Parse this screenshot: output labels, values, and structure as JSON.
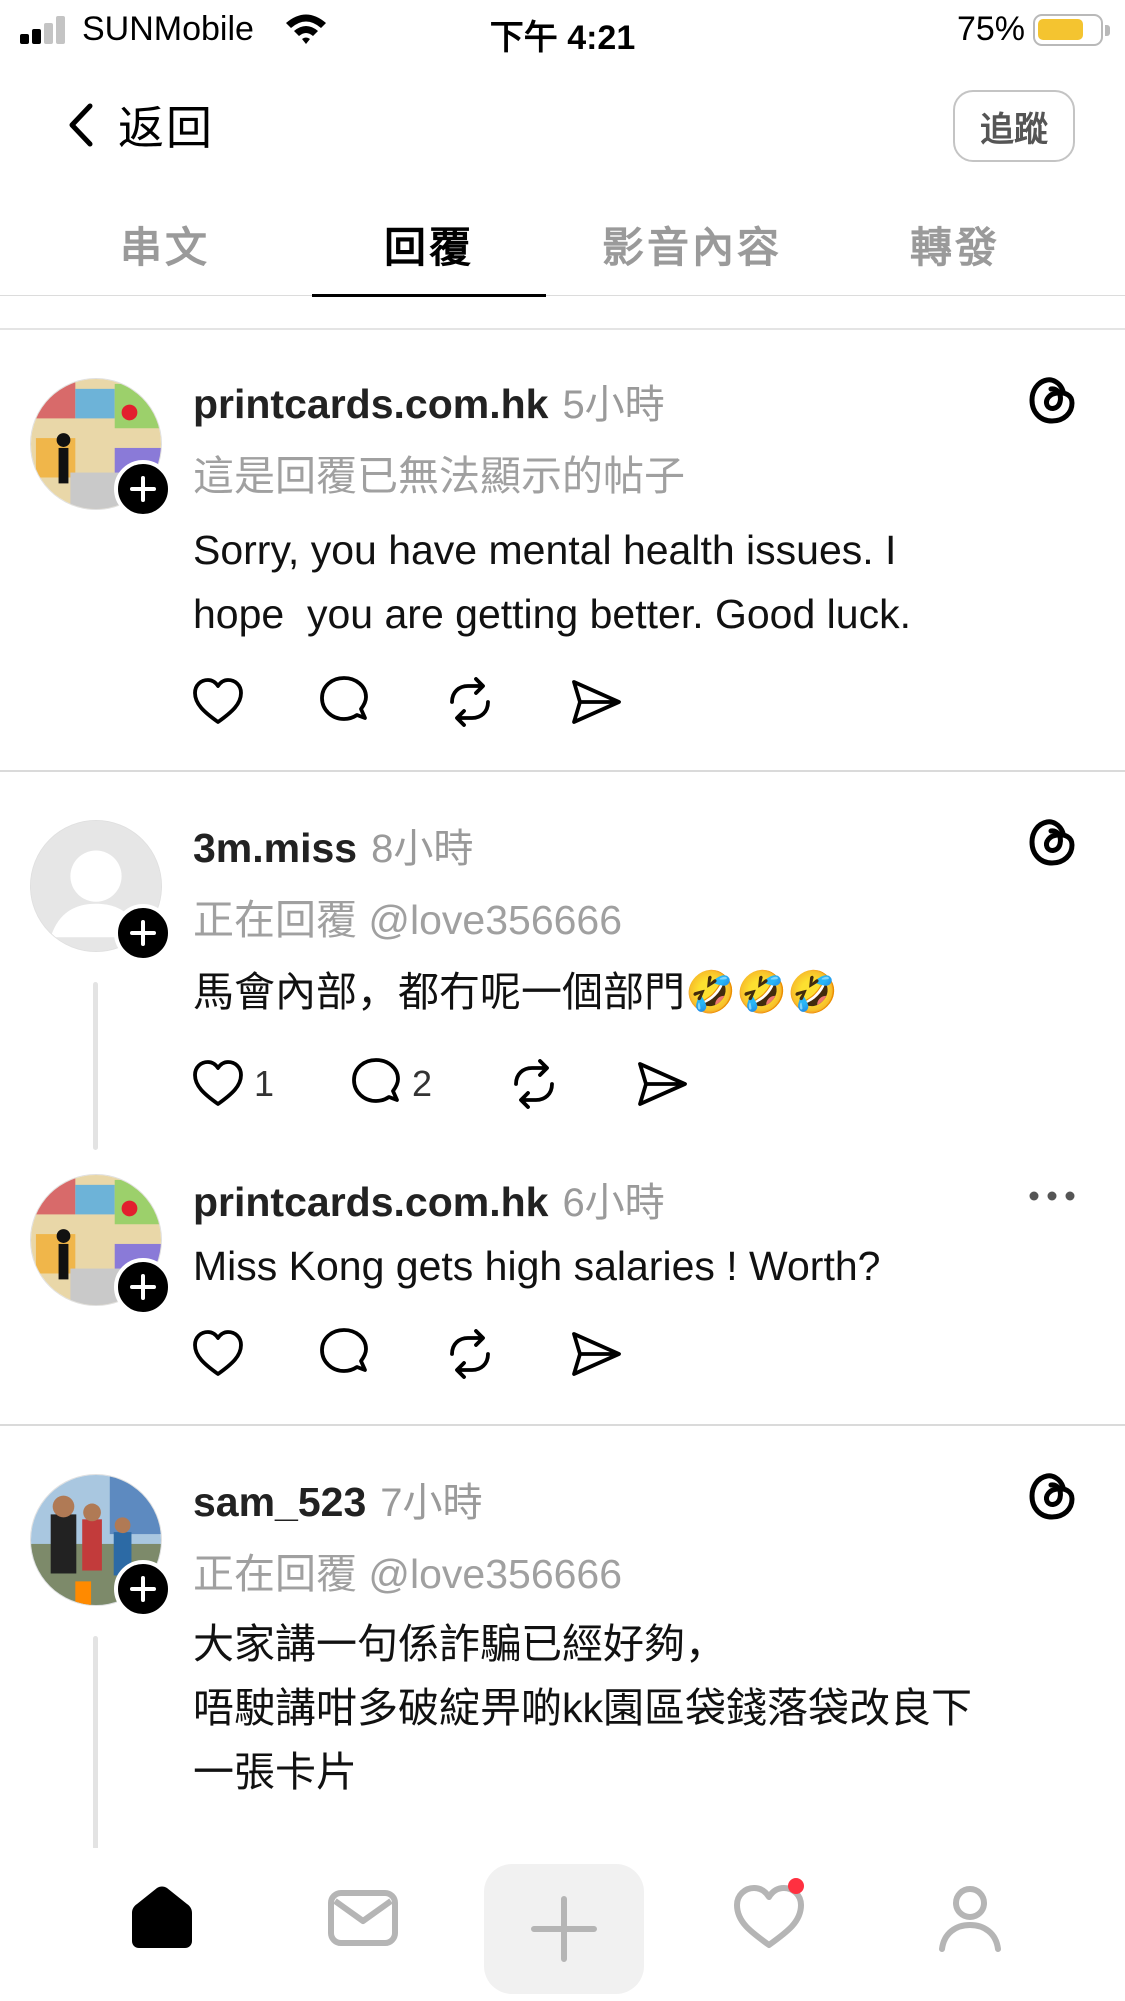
{
  "status_bar": {
    "carrier": "SUNMobile",
    "time": "下午 4:21",
    "battery_percent_label": "75%",
    "battery_level": 0.75,
    "battery_color": "#f4c430",
    "icons": [
      "signal-icon",
      "wifi-icon",
      "battery-icon"
    ]
  },
  "header": {
    "back_label": "返回",
    "follow_label": "追蹤"
  },
  "tabs": [
    {
      "label": "串文",
      "active": false
    },
    {
      "label": "回覆",
      "active": true
    },
    {
      "label": "影音內容",
      "active": false
    },
    {
      "label": "轉發",
      "active": false
    }
  ],
  "posts": [
    {
      "username": "printcards.com.hk",
      "time": "5小時",
      "subline": "這是回覆已無法顯示的帖子",
      "text": "Sorry, you have mental health issues. I\nhope  you are getting better. Good luck.",
      "corner_icon": "threads-logo-icon",
      "actions": {
        "like_count": "",
        "reply_count": ""
      }
    },
    {
      "username": "3m.miss",
      "time": "8小時",
      "subline": "正在回覆 @love356666",
      "text": "馬會內部，都冇呢一個部門🤣🤣🤣",
      "corner_icon": "threads-logo-icon",
      "actions": {
        "like_count": "1",
        "reply_count": "2"
      }
    },
    {
      "username": "printcards.com.hk",
      "time": "6小時",
      "text": "Miss Kong gets high salaries ! Worth?",
      "corner_icon": "more-icon",
      "actions": {
        "like_count": "",
        "reply_count": ""
      }
    },
    {
      "username": "sam_523",
      "time": "7小時",
      "subline": "正在回覆 @love356666",
      "text": "大家講一句係詐騙已經好夠，\n唔駛講咁多破綻畀啲kk園區袋錢落袋改良下\n一張卡片",
      "corner_icon": "threads-logo-icon"
    }
  ],
  "bottom_nav": {
    "items": [
      "home-icon",
      "inbox-icon",
      "create-icon",
      "activity-icon",
      "profile-icon"
    ],
    "notification_dot_color": "#ff3040"
  }
}
